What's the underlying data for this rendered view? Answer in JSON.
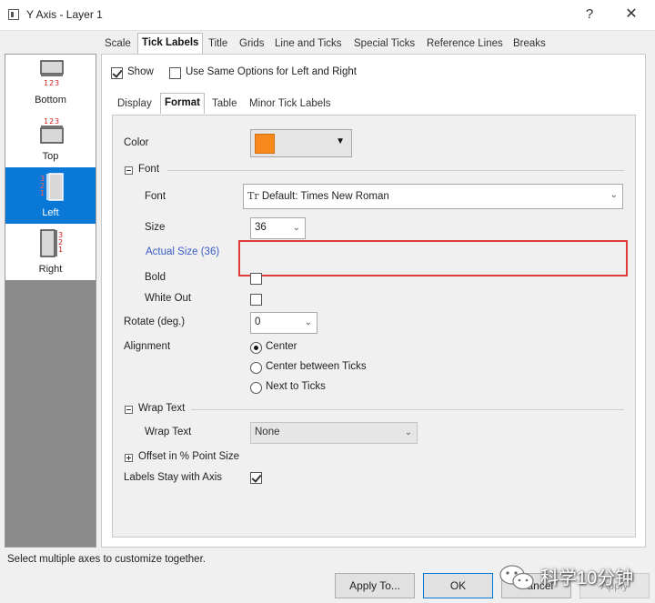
{
  "window": {
    "title": "Y Axis - Layer 1",
    "help_glyph": "?",
    "close_glyph": "✕"
  },
  "main_tabs": [
    "Scale",
    "Tick Labels",
    "Title",
    "Grids",
    "Line and Ticks",
    "Special Ticks",
    "Reference Lines",
    "Breaks"
  ],
  "main_tab_active": "Tick Labels",
  "sidebar": {
    "items": [
      {
        "label": "Bottom",
        "icon": "axis-bottom-icon",
        "selected": false
      },
      {
        "label": "Top",
        "icon": "axis-top-icon",
        "selected": false
      },
      {
        "label": "Left",
        "icon": "axis-left-icon",
        "selected": true
      },
      {
        "label": "Right",
        "icon": "axis-right-icon",
        "selected": false
      }
    ],
    "icon_digits": [
      "1",
      "2",
      "3"
    ]
  },
  "options": {
    "show_label": "Show",
    "show_checked": true,
    "same_options_label": "Use Same Options for Left and Right",
    "same_options_checked": false
  },
  "sub_tabs": [
    "Display",
    "Format",
    "Table",
    "Minor Tick Labels"
  ],
  "sub_tab_active": "Format",
  "format": {
    "color_label": "Color",
    "color_value": "#f7891c",
    "color_arrow": "▼",
    "font_section": "Font",
    "font_label": "Font",
    "font_icon": "Tr",
    "font_value": "Default: Times New Roman",
    "size_label": "Size",
    "size_value": "36",
    "actual_size": "Actual Size (36)",
    "bold_label": "Bold",
    "bold_checked": false,
    "white_out_label": "White Out",
    "white_out_checked": false,
    "rotate_label": "Rotate (deg.)",
    "rotate_value": "0",
    "alignment_label": "Alignment",
    "alignment_options": [
      "Center",
      "Center between Ticks",
      "Next to Ticks"
    ],
    "alignment_selected": "Center",
    "wrap_section": "Wrap Text",
    "wrap_label": "Wrap Text",
    "wrap_value": "None",
    "offset_section": "Offset in % Point Size",
    "stay_label": "Labels Stay with Axis",
    "stay_checked": true,
    "dropdown_arrow": "⌄"
  },
  "status": {
    "text": "Select multiple axes to customize together."
  },
  "buttons": {
    "apply_to": "Apply To...",
    "ok": "OK",
    "cancel": "Cancel",
    "apply": "Apply"
  },
  "watermark": {
    "text": "科学10分钟"
  }
}
